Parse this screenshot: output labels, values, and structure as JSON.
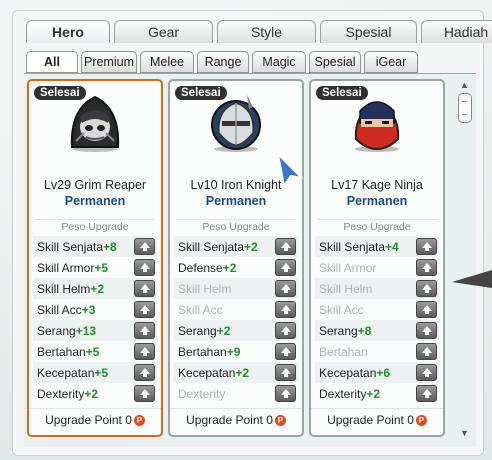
{
  "tabs_main": [
    {
      "label": "Hero",
      "active": true
    },
    {
      "label": "Gear",
      "active": false
    },
    {
      "label": "Style",
      "active": false
    },
    {
      "label": "Spesial",
      "active": false
    },
    {
      "label": "Hadiah",
      "active": false
    }
  ],
  "tabs_sub": [
    {
      "label": "All",
      "active": true
    },
    {
      "label": "Premium",
      "active": false
    },
    {
      "label": "Melee",
      "active": false
    },
    {
      "label": "Range",
      "active": false
    },
    {
      "label": "Magic",
      "active": false
    },
    {
      "label": "Spesial",
      "active": false
    },
    {
      "label": "iGear",
      "active": false
    }
  ],
  "heroes": [
    {
      "badge": "Selesai",
      "name": "Lv29 Grim Reaper",
      "status": "Permanen",
      "peso_label": "Peso Upgrade",
      "selected": true,
      "stats": [
        {
          "name": "Skill Senjata",
          "bonus": "+8",
          "dim": false
        },
        {
          "name": "Skill Armor",
          "bonus": "+5",
          "dim": false
        },
        {
          "name": "Skill Helm",
          "bonus": "+2",
          "dim": false
        },
        {
          "name": "Skill Acc",
          "bonus": "+3",
          "dim": false
        },
        {
          "name": "Serang",
          "bonus": "+13",
          "dim": false
        },
        {
          "name": "Bertahan",
          "bonus": "+5",
          "dim": false
        },
        {
          "name": "Kecepatan",
          "bonus": "+5",
          "dim": false
        },
        {
          "name": "Dexterity",
          "bonus": "+2",
          "dim": false
        }
      ],
      "upgrade_label": "Upgrade Point",
      "upgrade_points": "0"
    },
    {
      "badge": "Selesai",
      "name": "Lv10 Iron Knight",
      "status": "Permanen",
      "peso_label": "Peso Upgrade",
      "selected": false,
      "stats": [
        {
          "name": "Skill Senjata",
          "bonus": "+2",
          "dim": false
        },
        {
          "name": "Defense",
          "bonus": "+2",
          "dim": false
        },
        {
          "name": "Skill Helm",
          "bonus": "",
          "dim": true
        },
        {
          "name": "Skill Acc",
          "bonus": "",
          "dim": true
        },
        {
          "name": "Serang",
          "bonus": "+2",
          "dim": false
        },
        {
          "name": "Bertahan",
          "bonus": "+9",
          "dim": false
        },
        {
          "name": "Kecepatan",
          "bonus": "+2",
          "dim": false
        },
        {
          "name": "Dexterity",
          "bonus": "",
          "dim": true
        }
      ],
      "upgrade_label": "Upgrade Point",
      "upgrade_points": "0"
    },
    {
      "badge": "Selesai",
      "name": "Lv17 Kage Ninja",
      "status": "Permanen",
      "peso_label": "Peso Upgrade",
      "selected": false,
      "stats": [
        {
          "name": "Skill Senjata",
          "bonus": "+4",
          "dim": false
        },
        {
          "name": "Skill Armor",
          "bonus": "",
          "dim": true
        },
        {
          "name": "Skill Helm",
          "bonus": "",
          "dim": true
        },
        {
          "name": "Skill Acc",
          "bonus": "",
          "dim": true
        },
        {
          "name": "Serang",
          "bonus": "+8",
          "dim": false
        },
        {
          "name": "Bertahan",
          "bonus": "",
          "dim": true
        },
        {
          "name": "Kecepatan",
          "bonus": "+6",
          "dim": false
        },
        {
          "name": "Dexterity",
          "bonus": "+2",
          "dim": false
        }
      ],
      "upgrade_label": "Upgrade Point",
      "upgrade_points": "0"
    }
  ],
  "coin_glyph": "P",
  "colors": {
    "selected_border": "#d06b1c",
    "bonus_green": "#1f8f2a",
    "status_blue": "#1b4a8a",
    "coin_red": "#e14a1b"
  }
}
